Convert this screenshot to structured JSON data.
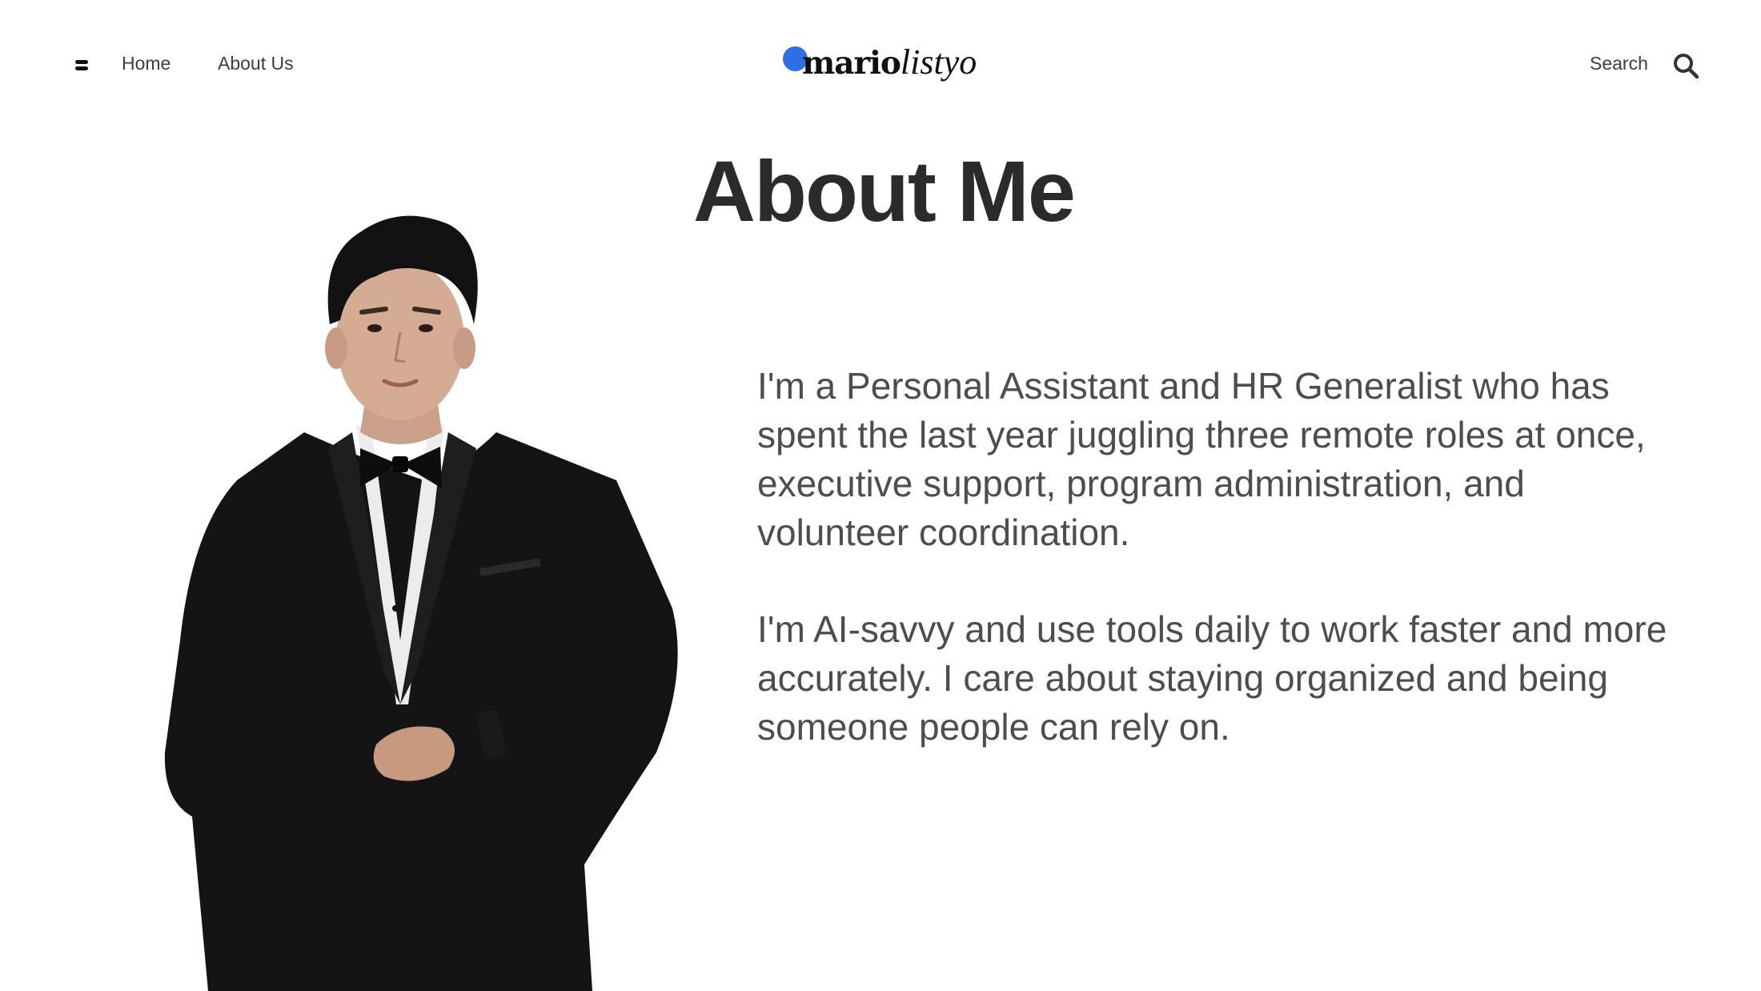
{
  "nav": {
    "menu_icon": "hamburger-icon",
    "links": [
      {
        "label": "Home"
      },
      {
        "label": "About Us"
      }
    ],
    "logo": {
      "bold": "mario",
      "italic": "listyo",
      "dot_color": "#2e6ee6"
    },
    "search_label": "Search",
    "search_icon": "search-icon"
  },
  "main": {
    "title": "About Me",
    "portrait": "portrait-photo",
    "paragraphs": [
      "I'm a Personal Assistant and HR Generalist who has spent the last year juggling three remote roles at once, executive support, program administration, and volunteer coordination.",
      "I'm AI-savvy and use tools daily to work faster and more accurately. I care about staying organized and being someone people can rely on."
    ]
  }
}
